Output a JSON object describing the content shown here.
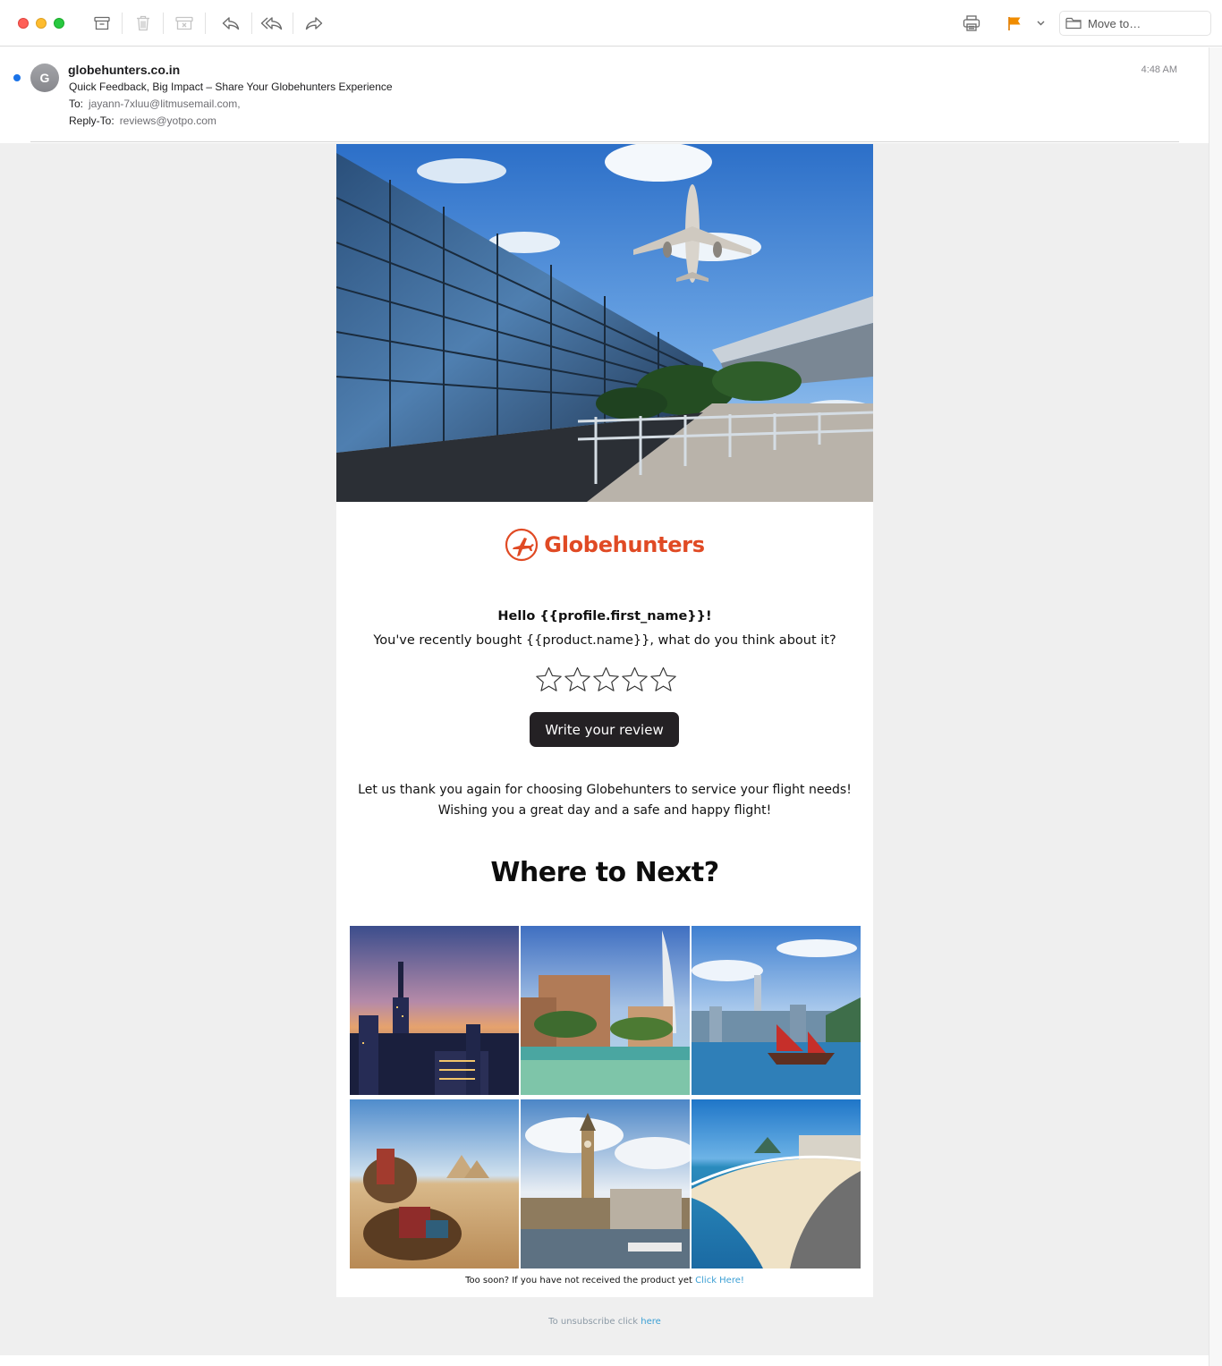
{
  "toolbar": {
    "move_to_label": "Move to…"
  },
  "message": {
    "sender_initial": "G",
    "sender": "globehunters.co.in",
    "subject": "Quick Feedback, Big Impact – Share Your Globehunters Experience",
    "to_label": "To:",
    "to_value": "jayann-7xluu@litmusemail.com,",
    "reply_to_label": "Reply-To:",
    "reply_to_value": "reviews@yotpo.com",
    "time": "4:48 AM"
  },
  "email": {
    "brand": "Globehunters",
    "greeting": "Hello {{profile.first_name}}!",
    "question": "You've recently bought {{product.name}}, what do you think about it?",
    "rating": {
      "value": 0,
      "max": 5
    },
    "review_button": "Write your review",
    "thanks_line1": "Let us thank you again for choosing Globehunters to service your flight needs!",
    "thanks_line2": "Wishing you a great day and a safe and happy flight!",
    "where_heading": "Where to Next?",
    "too_soon_text": "Too soon? If you have not received the product yet",
    "too_soon_link": "Click Here!",
    "unsubscribe_text": "To unsubscribe click",
    "unsubscribe_link": "here"
  },
  "colors": {
    "brand_red": "#e04a24",
    "button_dark": "#242124",
    "link_blue": "#3b9fd4",
    "flag_orange": "#f08c00",
    "unread_blue": "#1a73e8"
  }
}
